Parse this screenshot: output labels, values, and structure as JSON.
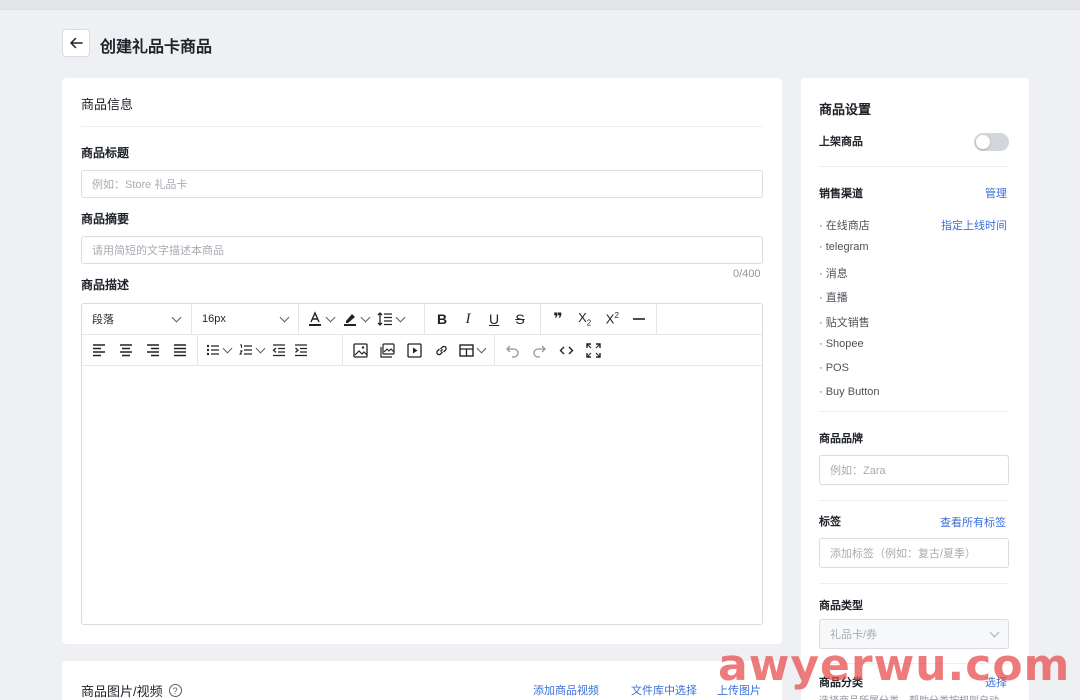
{
  "header": {
    "title": "创建礼品卡商品"
  },
  "product_info": {
    "section_title": "商品信息",
    "title_label": "商品标题",
    "title_placeholder": "例如：Store 礼品卡",
    "summary_label": "商品摘要",
    "summary_placeholder": "请用简短的文字描述本商品",
    "summary_counter": "0/400",
    "description_label": "商品描述"
  },
  "editor": {
    "block_format": "段落",
    "font_size": "16px"
  },
  "settings": {
    "title": "商品设置",
    "publish_label": "上架商品",
    "publish_enabled": false,
    "channels_label": "销售渠道",
    "channels_manage": "管理",
    "schedule_link": "指定上线时间",
    "channels": [
      "· 在线商店",
      "· telegram",
      "· 消息",
      "· 直播",
      "· 贴文销售",
      "· Shopee",
      "· POS",
      "· Buy Button"
    ],
    "brand_label": "商品品牌",
    "brand_placeholder": "例如：Zara",
    "tags_label": "标签",
    "tags_link": "查看所有标签",
    "tags_placeholder": "添加标签（例如：复古/夏季）",
    "type_label": "商品类型",
    "type_value": "礼品卡/券",
    "category_label": "商品分类",
    "category_link": "选择",
    "category_hint": "选择商品所属分类，帮助分类按规则自动"
  },
  "media": {
    "title": "商品图片/视频",
    "add_video": "添加商品视频",
    "from_library": "文件库中选择",
    "upload_image": "上传图片"
  },
  "watermark": "awyerwu.com"
}
